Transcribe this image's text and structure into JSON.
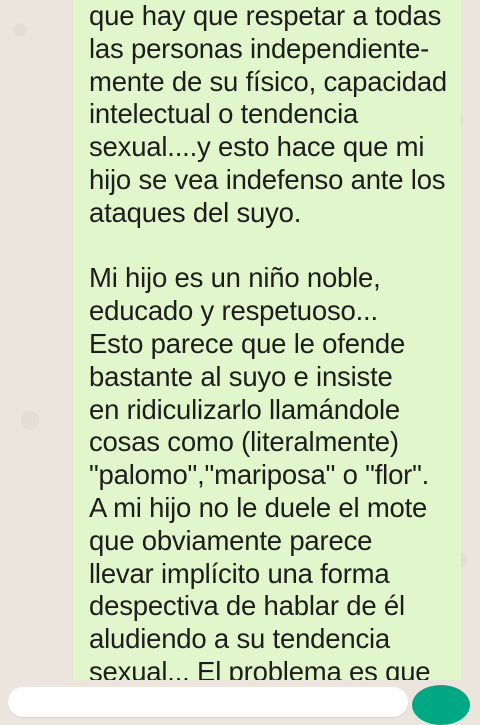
{
  "message": {
    "lines": [
      "que hay que respetar a todas",
      "las personas independiente-",
      "mente de su físico, capacidad",
      "intelectual o tendencia",
      "sexual....y esto hace que mi",
      "hijo se vea indefenso ante los",
      "ataques del suyo.",
      "",
      "Mi hijo es un niño noble,",
      "educado y respetuoso...",
      "Esto parece que le ofende",
      "bastante al suyo e insiste",
      "en ridiculizarlo llamándole",
      "cosas como (literalmente)",
      "\"palomo\",\"mariposa\" o \"flor\".",
      "A mi hijo no le duele el mote",
      "que obviamente parece",
      "llevar implícito una forma",
      "despectiva de hablar de él",
      "aludiendo a su tendencia",
      "sexual... El problema es que"
    ]
  },
  "colors": {
    "chat_background": "#ece5dd",
    "outgoing_bubble": "#e1f7cb",
    "send_button": "#00a884"
  },
  "icons": {
    "send": "send-icon"
  }
}
